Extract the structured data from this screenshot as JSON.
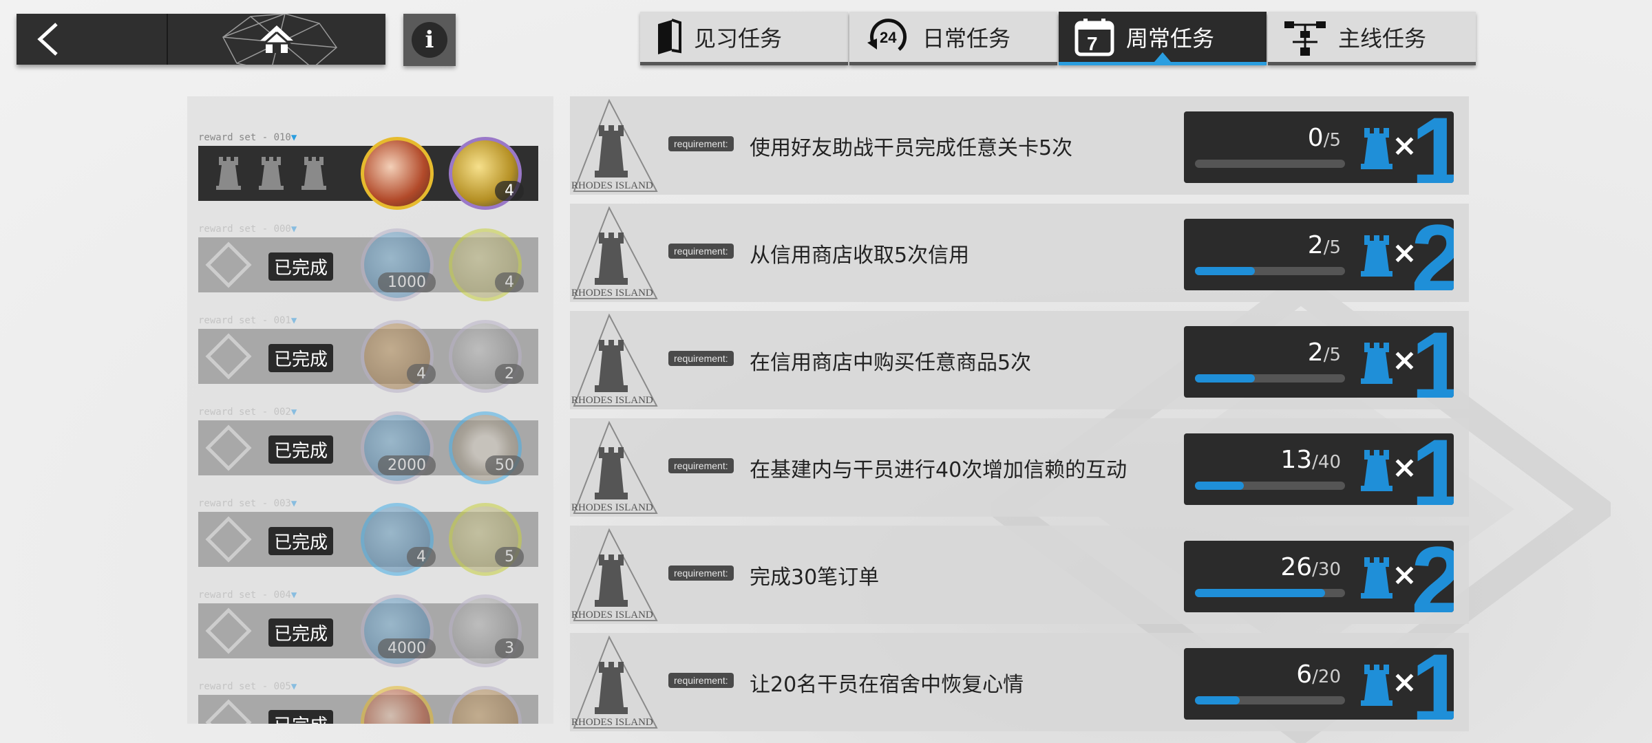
{
  "tabs": [
    {
      "label": "见习任务",
      "active": false
    },
    {
      "label": "日常任务",
      "active": false
    },
    {
      "label": "周常任务",
      "active": true
    },
    {
      "label": "主线任务",
      "active": false
    }
  ],
  "info_symbol": "i",
  "daily_icon_text": "24",
  "weekly_icon_text": "7",
  "reward_sets": [
    {
      "label": "reward  set - 010",
      "completed": false,
      "item1_qty": "",
      "item2_qty": "4",
      "rooks": 3
    },
    {
      "label": "reward  set - 000",
      "completed": true,
      "done_text": "已完成",
      "item1_qty": "1000",
      "item2_qty": "4"
    },
    {
      "label": "reward  set - 001",
      "completed": true,
      "done_text": "已完成",
      "item1_qty": "4",
      "item2_qty": "2"
    },
    {
      "label": "reward  set - 002",
      "completed": true,
      "done_text": "已完成",
      "item1_qty": "2000",
      "item2_qty": "50"
    },
    {
      "label": "reward  set - 003",
      "completed": true,
      "done_text": "已完成",
      "item1_qty": "4",
      "item2_qty": "5"
    },
    {
      "label": "reward  set - 004",
      "completed": true,
      "done_text": "已完成",
      "item1_qty": "4000",
      "item2_qty": "3"
    },
    {
      "label": "reward  set - 005",
      "completed": true,
      "done_text": "已完成",
      "item1_qty": "",
      "item2_qty": ""
    }
  ],
  "tasks": [
    {
      "tag": "requirement:",
      "desc": "使用好友助战干员完成任意关卡5次",
      "current": "0",
      "total": "5",
      "progress": 0.0,
      "reward": "1",
      "watermark": "RHODES ISLAND"
    },
    {
      "tag": "requirement:",
      "desc": "从信用商店收取5次信用",
      "current": "2",
      "total": "5",
      "progress": 0.4,
      "reward": "2",
      "watermark": "RHODES ISLAND"
    },
    {
      "tag": "requirement:",
      "desc": "在信用商店中购买任意商品5次",
      "current": "2",
      "total": "5",
      "progress": 0.4,
      "reward": "1",
      "watermark": "RHODES ISLAND"
    },
    {
      "tag": "requirement:",
      "desc": "在基建内与干员进行40次增加信赖的互动",
      "current": "13",
      "total": "40",
      "progress": 0.325,
      "reward": "1",
      "watermark": "RHODES ISLAND"
    },
    {
      "tag": "requirement:",
      "desc": "完成30笔订单",
      "current": "26",
      "total": "30",
      "progress": 0.8667,
      "reward": "2",
      "watermark": "RHODES ISLAND"
    },
    {
      "tag": "requirement:",
      "desc": "让20名干员在宿舍中恢复心情",
      "current": "6",
      "total": "20",
      "progress": 0.3,
      "reward": "1",
      "watermark": "RHODES ISLAND"
    }
  ],
  "colors": {
    "accent": "#1f8fd8",
    "dark": "#2b2b2b",
    "panel": "#d7d7d7"
  }
}
